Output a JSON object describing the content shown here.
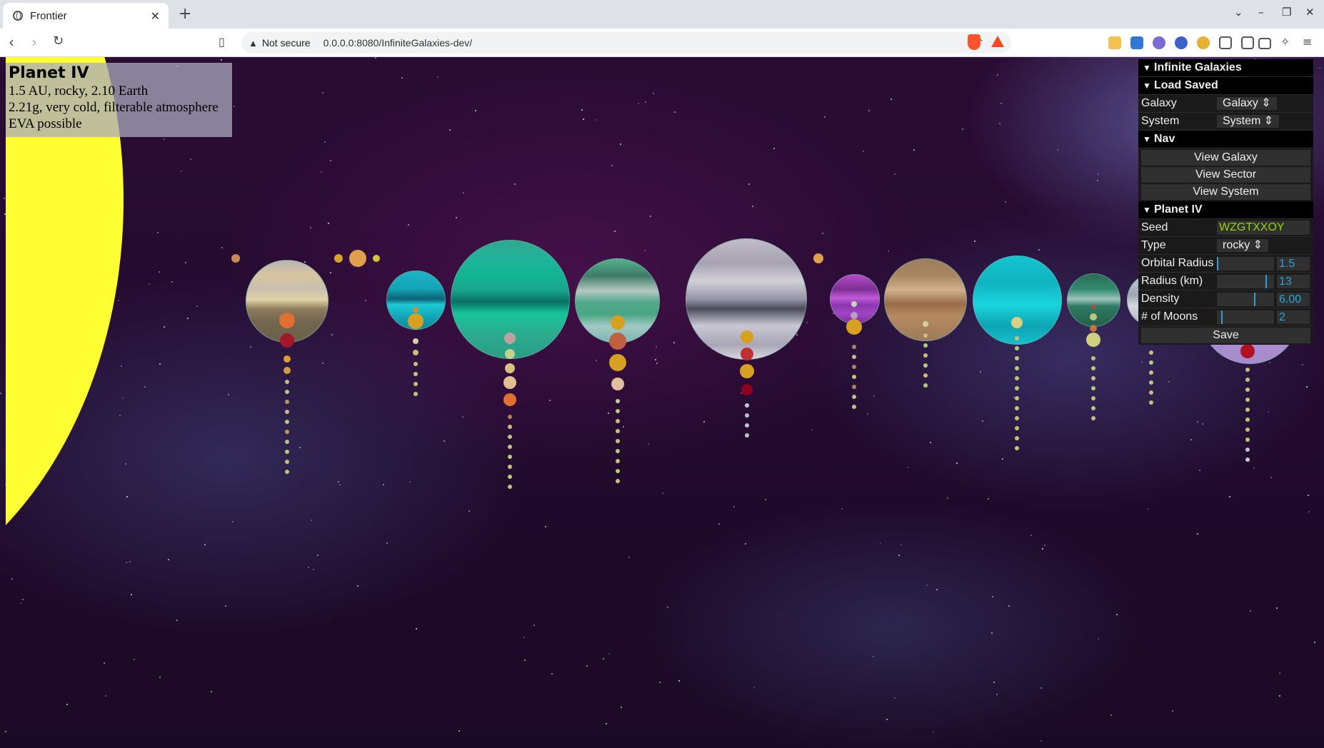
{
  "browser": {
    "tab_title": "Frontier",
    "tab_close": "✕",
    "new_tab": "+",
    "security_label": "Not secure",
    "url": "0.0.0.0:8080/InfiniteGalaxies-dev/"
  },
  "info_box": {
    "planet_name": "Planet IV",
    "line1": "1.5 AU, rocky, 2.10 Earth",
    "line2": "2.21g, very cold, filterable atmosphere",
    "line3": "EVA possible"
  },
  "gui": {
    "root_title": "Infinite Galaxies",
    "load_saved": {
      "title": "Load Saved",
      "galaxy_label": "Galaxy",
      "galaxy_value": "Galaxy",
      "system_label": "System",
      "system_value": "System"
    },
    "nav": {
      "title": "Nav",
      "view_galaxy": "View Galaxy",
      "view_sector": "View Sector",
      "view_system": "View System"
    },
    "planet": {
      "title": "Planet IV",
      "seed_label": "Seed",
      "seed_value": "WZGTXXOY",
      "type_label": "Type",
      "type_value": "rocky",
      "orbital_radius_label": "Orbital Radius",
      "orbital_radius_value": "1.5",
      "orbital_radius_fraction": 0.02,
      "radius_label": "Radius (km)",
      "radius_value": "13",
      "radius_fraction": 0.88,
      "density_label": "Density",
      "density_value": "6.00",
      "density_fraction": 0.67,
      "moons_label": "# of Moons",
      "moons_value": "2",
      "moons_fraction": 0.1,
      "save_label": "Save"
    }
  },
  "colors": {
    "sun": "#ffff33",
    "gui_accent": "#2fa1d6",
    "seed_text": "#95d600"
  },
  "icons": [
    "globe-icon",
    "back-icon",
    "forward-icon",
    "reload-icon",
    "bookmark-icon",
    "warning-icon",
    "share-icon",
    "brave-icon",
    "bat-icon",
    "chevron-down-icon",
    "minimize-icon",
    "maximize-icon",
    "close-icon",
    "menu-icon"
  ]
}
